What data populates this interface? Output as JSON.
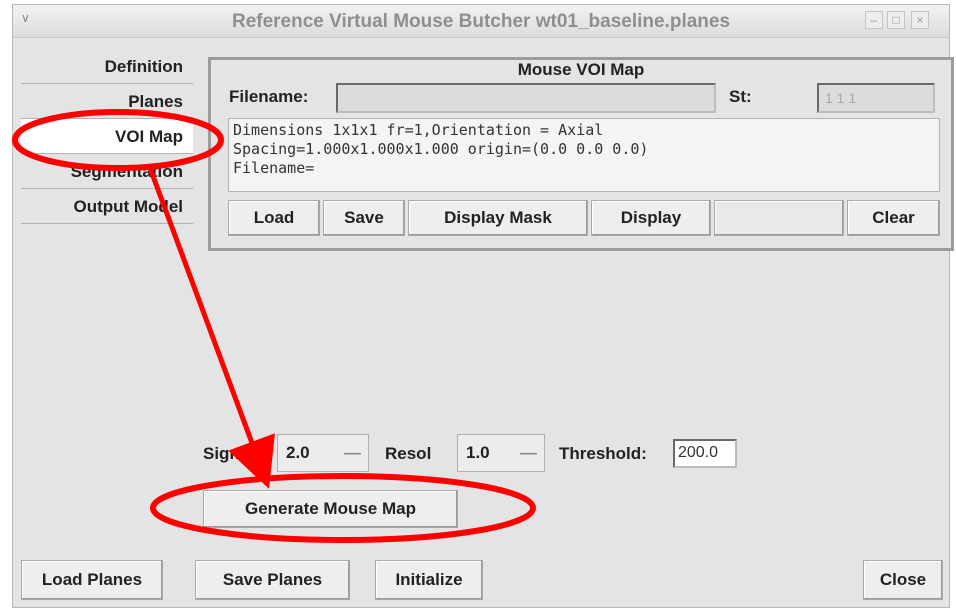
{
  "window": {
    "title": "Reference Virtual Mouse Butcher wt01_baseline.planes",
    "menu_glyph": "∨",
    "controls": [
      "–",
      "□",
      "×"
    ]
  },
  "nav": {
    "items": [
      {
        "label": "Definition"
      },
      {
        "label": "Planes"
      },
      {
        "label": "VOI Map",
        "active": true
      },
      {
        "label": "Segmentation"
      },
      {
        "label": "Output Model"
      }
    ]
  },
  "voi_panel": {
    "title": "Mouse VOI Map",
    "filename_label": "Filename:",
    "filename_value": "",
    "st_label": "St:",
    "st_value": "1 1 1",
    "info_lines": "Dimensions 1x1x1 fr=1,Orientation = Axial\nSpacing=1.000x1.000x1.000 origin=(0.0 0.0 0.0)\nFilename=",
    "buttons": {
      "load": "Load",
      "save": "Save",
      "display_mask": "Display Mask",
      "display": "Display",
      "clear": "Clear"
    }
  },
  "params": {
    "sigma_label": "Sigma",
    "sigma_value": "2.0",
    "resol_label": "Resol",
    "resol_value": "1.0",
    "threshold_label": "Threshold:",
    "threshold_value": "200.0",
    "spin_glyph": "—"
  },
  "generate_button": "Generate Mouse Map",
  "footer": {
    "load_planes": "Load Planes",
    "save_planes": "Save Planes",
    "initialize": "Initialize",
    "close": "Close"
  },
  "annotation": {
    "color": "#ff0000"
  }
}
